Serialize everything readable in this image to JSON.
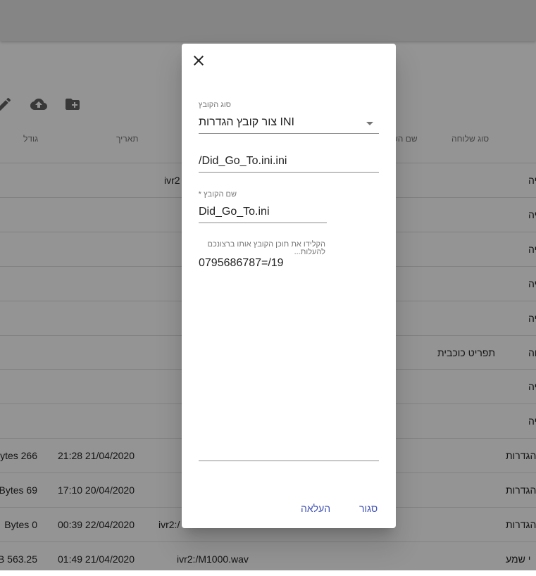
{
  "toolbar": {
    "icons": [
      "pencil-icon",
      "cloud-upload-icon",
      "new-folder-icon"
    ]
  },
  "table": {
    "headers": {
      "size": "גודל",
      "date": "תאריך",
      "sender_name": "שם הש",
      "extension_type": "סוג שלוחה"
    },
    "rows": [
      {
        "size": "",
        "date": "",
        "name": "ivr2",
        "ext": "",
        "type": "יה"
      },
      {
        "size": "",
        "date": "",
        "name": "",
        "ext": "",
        "type": "יה"
      },
      {
        "size": "",
        "date": "",
        "name": "",
        "ext": "",
        "type": "יה"
      },
      {
        "size": "",
        "date": "",
        "name": "",
        "ext": "",
        "type": "יה"
      },
      {
        "size": "",
        "date": "",
        "name": "",
        "ext": "",
        "type": "יה"
      },
      {
        "size": "",
        "date": "",
        "name": "",
        "ext": "תפריט כוכבית",
        "type": "חה"
      },
      {
        "size": "",
        "date": "",
        "name": "",
        "ext": "",
        "type": "יה"
      },
      {
        "size": "",
        "date": "",
        "name": "",
        "ext": "",
        "type": "יה"
      },
      {
        "size": "Bytes 266",
        "date": "21:28 21/04/2020",
        "name": "",
        "ext": "",
        "type": "י הגדרות"
      },
      {
        "size": "Bytes 69",
        "date": "17:10 20/04/2020",
        "name": "",
        "ext": "",
        "type": "י הגדרות"
      },
      {
        "size": "Bytes 0",
        "date": "00:39 22/04/2020",
        "name": "ivr2:/",
        "ext": "",
        "type": "י הגדרות"
      },
      {
        "size": "KB 563.25",
        "date": "01:49 21/04/2020",
        "name": "ivr2:/M1000.wav",
        "ext": "",
        "type": "י שמע"
      }
    ]
  },
  "dialog": {
    "close_icon": "close-icon",
    "file_type_label": "סוג הקובץ",
    "file_type_value": "צור קובץ הגדרות INI",
    "path_value": "/Did_Go_To.ini.ini",
    "file_name_label": "שם הקובץ *",
    "file_name_value": "Did_Go_To.ini",
    "content_label": "הקלידו את תוכן הקובץ אותו ברצונכם להעלות...",
    "content_value": "0795686787=/19",
    "upload_button": "העלאה",
    "close_button": "סגור"
  }
}
